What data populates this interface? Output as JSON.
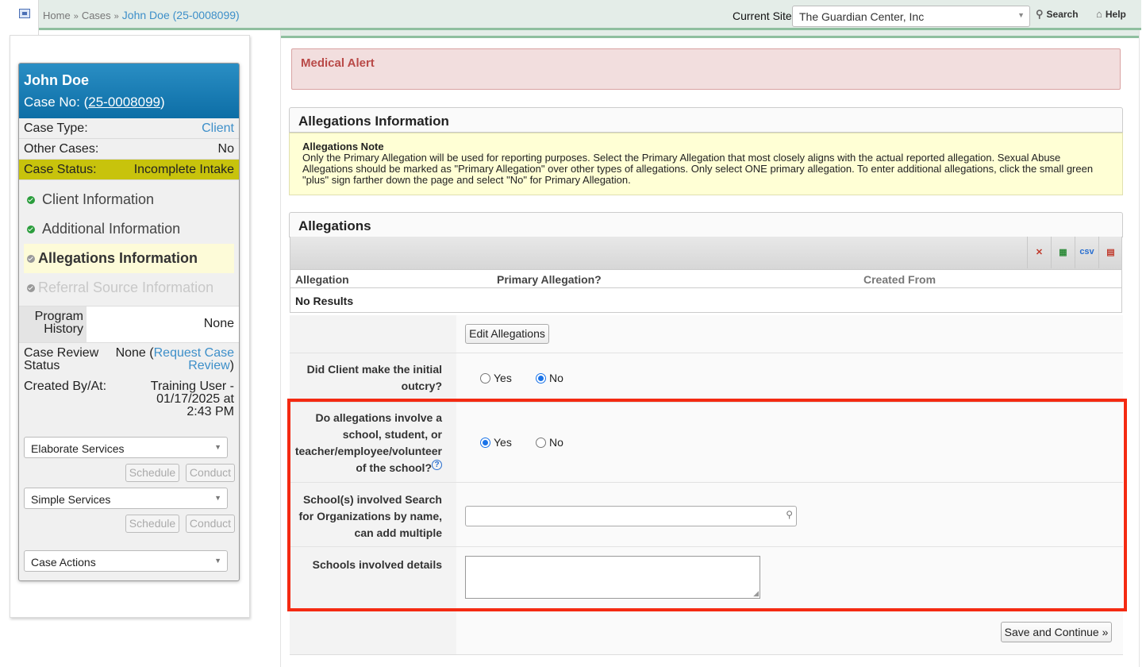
{
  "breadcrumb": {
    "home": "Home",
    "sep": "»",
    "cases": "Cases",
    "current": "John Doe (25-0008099)"
  },
  "site": {
    "label": "Current Site",
    "value": "The Guardian Center, Inc"
  },
  "top_actions": {
    "search": "Search",
    "help": "Help"
  },
  "case": {
    "name": "John Doe",
    "case_no_label": "Case No: (",
    "case_no": "25-0008099",
    "case_no_close": ")",
    "type_label": "Case Type:",
    "type_value": "Client",
    "other_label": "Other Cases:",
    "other_value": "No",
    "status_label": "Case Status:",
    "status_value": "Incomplete Intake",
    "nav": [
      {
        "label": "Client Information",
        "state": "done"
      },
      {
        "label": "Additional Information",
        "state": "done"
      },
      {
        "label": "Allegations Information",
        "state": "active"
      },
      {
        "label": "Referral Source Information",
        "state": "disabled"
      }
    ],
    "program_history_label": "Program History",
    "program_history_value": "None",
    "review_label": "Case Review Status",
    "review_value_prefix": "None (",
    "review_link": "Request Case Review",
    "review_value_suffix": ")",
    "created_label": "Created By/At:",
    "created_value": "Training User - 01/17/2025 at 2:43 PM",
    "elaborate_services": "Elaborate Services",
    "simple_services": "Simple Services",
    "schedule": "Schedule",
    "conduct": "Conduct",
    "case_actions": "Case Actions"
  },
  "medical_alert": "Medical Alert",
  "allegations_info": {
    "title": "Allegations Information",
    "note_title": "Allegations Note",
    "note_text": "Only the Primary Allegation will be used for reporting purposes. Select the Primary Allegation that most closely aligns with the actual reported allegation. Sexual Abuse Allegations should be marked as \"Primary Allegation\" over other types of allegations. Only select ONE primary allegation. To enter additional allegations, click the small green \"plus\" sign farther down the page and select \"No\" for Primary Allegation."
  },
  "allegations": {
    "title": "Allegations",
    "toolbar_icons": [
      "clear-filter-icon",
      "excel-export-icon",
      "csv-export-icon",
      "pdf-export-icon"
    ],
    "csv_label": "csv",
    "columns": [
      "Allegation",
      "Primary Allegation?",
      "Created From"
    ],
    "empty": "No Results",
    "edit_button": "Edit Allegations"
  },
  "form": {
    "outcry_label": "Did Client make the initial outcry?",
    "outcry_value": "No",
    "school_label": "Do allegations involve a school, student, or teacher/employee/volunteer of the school?",
    "school_value": "Yes",
    "yes": "Yes",
    "no": "No",
    "help_glyph": "?",
    "schools_label": "School(s) involved Search for Organizations by name, can add multiple",
    "schools_value": "",
    "details_label": "Schools involved details",
    "details_value": "",
    "save_button": "Save and Continue »"
  },
  "colors": {
    "accent": "#3d8fc9",
    "status_bg": "#c8c30c",
    "highlight": "#f42a12",
    "alert_bg": "#f2dede"
  }
}
